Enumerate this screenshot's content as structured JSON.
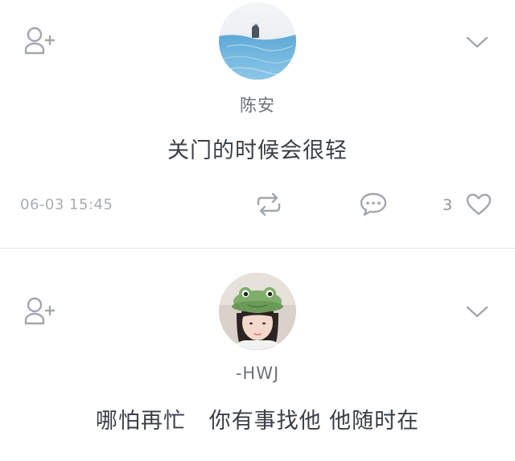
{
  "posts": [
    {
      "username": "陈安",
      "text": "关门的时候会很轻",
      "timestamp": "06-03 15:45",
      "like_count": "3",
      "avatar": "sea-cat-avatar"
    },
    {
      "username": "-HWJ",
      "text": "哪怕再忙   你有事找他 他随时在",
      "avatar": "girl-frog-hat-avatar"
    }
  ],
  "icons": {
    "follow": "add-user-icon",
    "more": "chevron-down-icon",
    "repost": "repost-icon",
    "comment": "comment-icon",
    "like": "heart-icon"
  },
  "colors": {
    "icon_gray": "#a3a7ab",
    "text_dark": "#3a3f44",
    "text_muted": "#a9adb1",
    "divider": "#e3e3e3"
  }
}
